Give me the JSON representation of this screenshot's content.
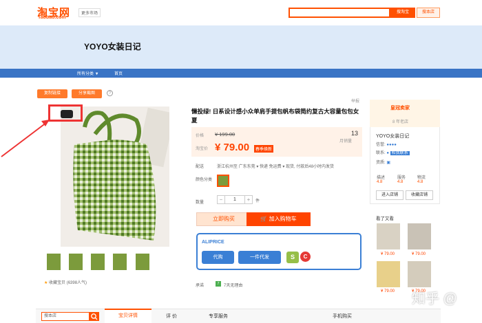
{
  "header": {
    "logo_cn": "淘宝网",
    "logo_en": "Taobao.com",
    "more_market": "更多市场",
    "search_tb": "搜淘宝",
    "search_store": "搜本店"
  },
  "shop": {
    "title": "YOYO女装日记",
    "nav": [
      "所有分类 ▼",
      "首页"
    ]
  },
  "actions": {
    "copy_link": "复制链接",
    "share_shot": "分享截图",
    "help": "?"
  },
  "product": {
    "title": "懒投绿! 日系设计感小众单肩手提包帆布袋简约复古大容量包包女夏",
    "price_label": "价格",
    "orig_price": "¥ 199.00",
    "tb_price_label": "淘宝价",
    "sale_price": "¥ 79.00",
    "promo_tag": "春季焕新",
    "sales_count": "13",
    "sales_label": "月销量",
    "ship_label": "配送",
    "ship_text": "浙江杭州至 广东东莞 ▾  快递 免运费 ▾  现货, 付款后48小时内发货",
    "color_label": "颜色分类",
    "qty_label": "数量",
    "qty_value": "1",
    "qty_unit": "件",
    "buy_now": "立即购买",
    "add_cart": "加入购物车",
    "promise_label": "承诺",
    "promise_text": "7天无理由",
    "fav": "收藏宝贝 (6398人气)",
    "report": "举报"
  },
  "aliprice": {
    "title": "ALIPRICE",
    "daigou": "代购",
    "dropship": "一件代发",
    "shopify_icon": "S",
    "other_icon": "C"
  },
  "seller": {
    "badge": "皇冠卖家",
    "age": "8 年老店",
    "name": "YOYO女装日记",
    "credit_label": "信誉:",
    "contact_label": "联系:",
    "contact_tag": "和我联系",
    "qual_label": "资质:",
    "scores": [
      {
        "label": "描述",
        "value": "4.8"
      },
      {
        "label": "服务",
        "value": "4.8"
      },
      {
        "label": "物流",
        "value": "4.8"
      }
    ],
    "enter_store": "进入店铺",
    "fav_store": "收藏店铺"
  },
  "seen": {
    "title": "看了又看",
    "prices": [
      "¥ 79.00",
      "¥ 79.00",
      "¥ 79.00",
      "¥ 79.00"
    ]
  },
  "bottom": {
    "search_placeholder": "搜本店",
    "tabs": [
      "宝贝详情",
      "评 价",
      "专享服务",
      "手机购买"
    ]
  },
  "watermark": "知乎 @",
  "colors": {
    "brand": "#ff5000",
    "accent_blue": "#3a7fd5",
    "banner": "#ddeaf9"
  }
}
